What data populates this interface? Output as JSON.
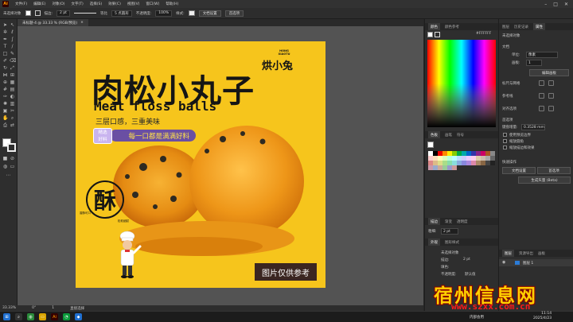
{
  "app": {
    "logo": "Ai",
    "menus": [
      "文件(F)",
      "编辑(E)",
      "对象(O)",
      "文字(T)",
      "选择(S)",
      "效果(C)",
      "视图(V)",
      "窗口(W)",
      "帮助(H)"
    ]
  },
  "controlbar": {
    "selection_label": "未选择对象",
    "stroke_label": "描边:",
    "stroke_value": "2 pt",
    "brush_label": "等比",
    "brush_value": "5 点圆形",
    "opacity_label": "不透明度:",
    "opacity_value": "100%",
    "style_label": "样式:",
    "doc_settings": "文档设置",
    "preferences": "首选项"
  },
  "document_tab": {
    "title": "未标题-4 @ 33.33 % (RGB/预览)",
    "close": "×"
  },
  "artboard": {
    "brand_small": "HONG XIAOTU",
    "brand_name": "烘小兔",
    "title_cn": "肉松小丸子",
    "title_en": "Meat floss balls",
    "subtitle": "三层口感，三重美味",
    "badge_line1": "精选",
    "badge_line2": "好料",
    "banner": "每一口都是满满好料",
    "su_char": "酥",
    "su_label_left": "香酥可口",
    "su_label_right": "松软细腻",
    "photo_note": "图片仅供参考"
  },
  "statusbar": {
    "zoom": "33.33%",
    "angle": "0°",
    "page": "1",
    "tool": "直接选择"
  },
  "panels_left": {
    "tabs_top": [
      "颜色",
      "颜色参考"
    ],
    "hex_value": "#FFFFFF",
    "tabs_swatch": [
      "色板",
      "画笔",
      "符号"
    ],
    "tabs_stroke": [
      "描边",
      "渐变",
      "透明度"
    ],
    "stroke_label": "粗细:",
    "stroke_value": "2 pt",
    "tabs_appearance": [
      "外观",
      "图形样式"
    ],
    "appearance_title": "未选择对象",
    "appearance_rows": [
      "描边:",
      "填色:",
      "不透明度:"
    ],
    "appearance_stroke_value": "2 pt",
    "appearance_opacity_value": "默认值"
  },
  "panels_right": {
    "tabs": [
      "图层",
      "历史记录",
      "属性"
    ],
    "section_title": "未选择对象",
    "doc_label": "文档",
    "unit_label": "单位:",
    "unit_value": "像素",
    "artboard_label": "画板:",
    "artboard_value": "1",
    "edit_artboard": "编辑画板",
    "ruler_grid": "标尺与网格",
    "guides": "参考线",
    "snap": "对齐选项",
    "prefs_title": "首选项",
    "keyboard_label": "键盘增量:",
    "keyboard_value": "0.3528 mm",
    "option1": "使用预览边界",
    "option2": "缩放圆角",
    "option3": "缩放描边和效果",
    "quick_actions": "快速操作",
    "doc_settings_btn": "文档设置",
    "prefs_btn": "首选项",
    "beta_btn": "生成矢量 (Beta)",
    "layer_tabs": [
      "图层",
      "资源导出",
      "画板"
    ],
    "layer_name": "图层 1"
  },
  "taskbar": {
    "time": "11:14",
    "date": "2025/4/23",
    "status_text": "内部会用"
  },
  "watermark": {
    "text": "宿州信息网",
    "url": "www.szxx.com.cn"
  },
  "colors": {
    "artboard_bg": "#f6c51c",
    "banner": "#6a4fa3",
    "banner_text": "#ffe24a",
    "note_bg": "#3b2621"
  }
}
